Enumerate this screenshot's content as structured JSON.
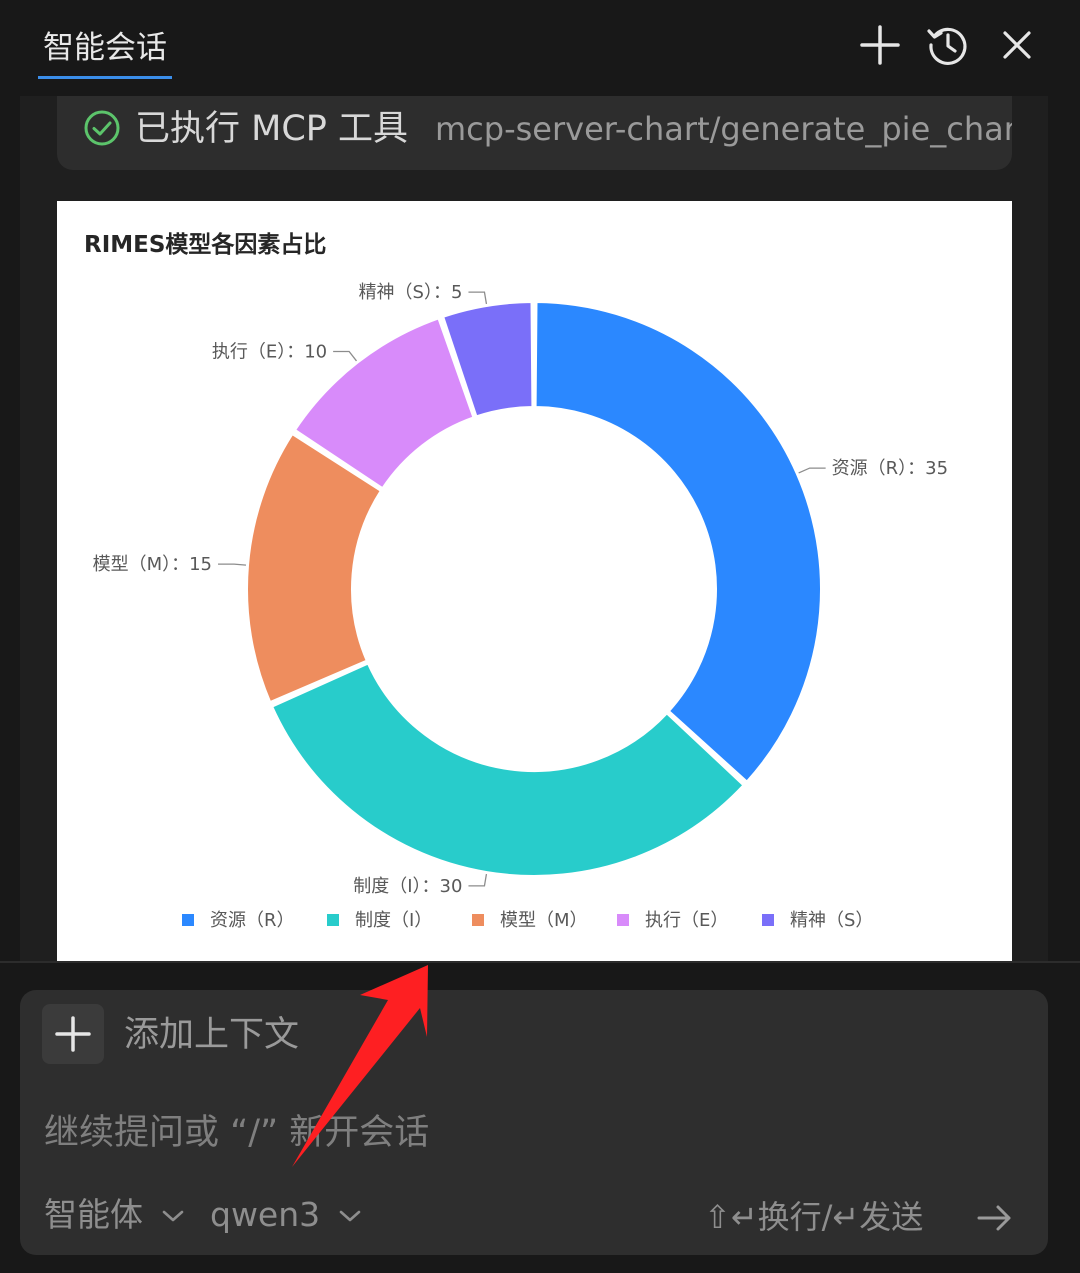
{
  "header": {
    "tab_label": "智能会话",
    "icons": [
      "plus-icon",
      "history-icon",
      "close-icon"
    ]
  },
  "tool_call": {
    "status_label": "已执行 MCP 工具",
    "tool_name": "mcp-server-chart/generate_pie_char",
    "icon": "check-circle-icon",
    "status_color": "#5cc46b"
  },
  "chart_data": {
    "type": "pie",
    "variant": "donut",
    "title": "RIMES模型各因素占比",
    "categories": [
      "资源（R）",
      "制度（I）",
      "模型（M）",
      "执行（E）",
      "精神（S）"
    ],
    "values": [
      35,
      30,
      15,
      10,
      5
    ],
    "slice_labels": [
      "资源（R）：35",
      "制度（I）：30",
      "模型（M）：15",
      "执行（E）：10",
      "精神（S）：5"
    ],
    "colors": [
      "#2b88ff",
      "#28cccb",
      "#ee8d5e",
      "#d88bfa",
      "#7a6ff9"
    ],
    "legend": "bottom"
  },
  "input": {
    "add_context_label": "添加上下文",
    "placeholder": "继续提问或 “/” 新开会话",
    "agent_selector": "智能体",
    "model_selector": "qwen3",
    "shortcut_hint": "⇧↵换行/↵发送"
  }
}
